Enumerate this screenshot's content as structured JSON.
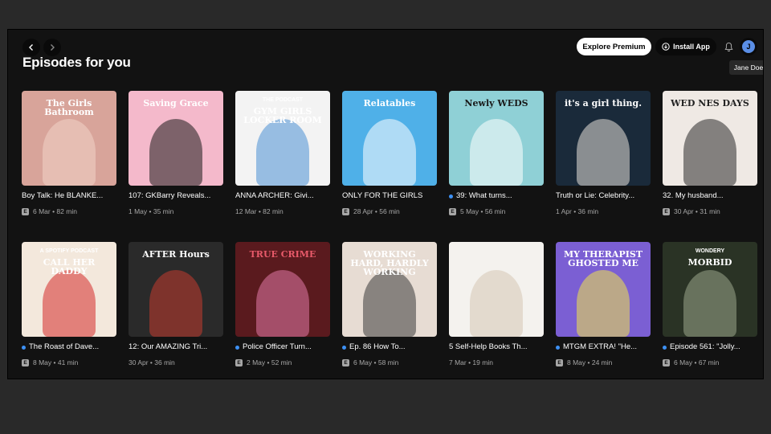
{
  "header": {
    "section_title": "Episodes for you",
    "explore_premium_label": "Explore Premium",
    "install_app_label": "Install App",
    "avatar_initial": "J",
    "tooltip_name": "Jane Doe"
  },
  "colors": {
    "background": "#121212",
    "outer": "#292929",
    "unplayed_dot": "#3d91f4",
    "avatar": "#5a8ee6"
  },
  "episodes": [
    {
      "title": "Boy Talk: He BLANKE...",
      "meta": "6 Mar • 82 min",
      "explicit": true,
      "unplayed": false,
      "cover": {
        "bg": "#d8a49a",
        "accent": "#f2d4c8",
        "text": "The Girls Bathroom",
        "text_color": "#ffffff"
      }
    },
    {
      "title": "107: GKBarry Reveals...",
      "meta": "1 May • 35 min",
      "explicit": false,
      "unplayed": false,
      "cover": {
        "bg": "#f4b9cb",
        "accent": "#1c1c1c",
        "text": "Saving Grace",
        "text_color": "#ffffff"
      }
    },
    {
      "title": "ANNA ARCHER: Givi...",
      "meta": "12 Mar • 82 min",
      "explicit": false,
      "unplayed": false,
      "cover": {
        "bg": "#f3f3f3",
        "accent": "#4a8fd3",
        "text": "GYM GIRLS LOCKER ROOM",
        "text_color": "#ffffff",
        "text2": "THE PODCAST"
      }
    },
    {
      "title": "ONLY FOR THE GIRLS",
      "meta": "28 Apr • 56 min",
      "explicit": true,
      "unplayed": false,
      "cover": {
        "bg": "#4fb0e8",
        "accent": "#ffffff",
        "text": "Relatables",
        "text_color": "#ffffff"
      }
    },
    {
      "title": "39: What turns...",
      "meta": "5 May • 56 min",
      "explicit": true,
      "unplayed": true,
      "cover": {
        "bg": "#8fd0d6",
        "accent": "#ffffff",
        "text": "Newly WEDS",
        "text_color": "#1a1a1a"
      }
    },
    {
      "title": "Truth or Lie: Celebrity...",
      "meta": "1 Apr • 36 min",
      "explicit": false,
      "unplayed": false,
      "cover": {
        "bg": "#1a2a3a",
        "accent": "#e8e0d8",
        "text": "it's a girl thing.",
        "text_color": "#ffffff"
      }
    },
    {
      "title": "32. My husband...",
      "meta": "30 Apr • 31 min",
      "explicit": true,
      "unplayed": false,
      "cover": {
        "bg": "#efe9e4",
        "accent": "#2a2a2a",
        "text": "WED NES DAYS",
        "text_color": "#222222"
      }
    },
    {
      "title": "The Roast of Dave...",
      "meta": "8 May • 41 min",
      "explicit": true,
      "unplayed": true,
      "cover": {
        "bg": "#f3e8dc",
        "accent": "#d42a2a",
        "text": "CALL HER DADDY",
        "text_color": "#ffffff",
        "text2": "A SPOTIFY PODCAST"
      }
    },
    {
      "title": "12: Our AMAZING Tri...",
      "meta": "30 Apr • 36 min",
      "explicit": false,
      "unplayed": false,
      "cover": {
        "bg": "#2a2a2a",
        "accent": "#c23a2e",
        "text": "AFTER Hours",
        "text_color": "#ffffff"
      }
    },
    {
      "title": "Police Officer Turn...",
      "meta": "2 May • 52 min",
      "explicit": true,
      "unplayed": true,
      "cover": {
        "bg": "#5a1a1e",
        "accent": "#e27aa8",
        "text": "TRUE CRIME",
        "text_color": "#e85a6a"
      }
    },
    {
      "title": "Ep. 86 How To...",
      "meta": "6 May • 58 min",
      "explicit": true,
      "unplayed": true,
      "cover": {
        "bg": "#e7dcd3",
        "accent": "#3a3a3a",
        "text": "WORKING HARD, HARDLY WORKING",
        "text_color": "#ffffff"
      }
    },
    {
      "title": "5 Self-Help Books Th...",
      "meta": "7 Mar • 19 min",
      "explicit": false,
      "unplayed": false,
      "cover": {
        "bg": "#f4f2ee",
        "accent": "#d6c7b5",
        "text": "",
        "text_color": "#333333"
      }
    },
    {
      "title": "MTGM EXTRA! \"He...",
      "meta": "8 May • 24 min",
      "explicit": true,
      "unplayed": true,
      "cover": {
        "bg": "#7b5fd3",
        "accent": "#f1e34a",
        "text": "MY THERAPIST GHOSTED ME",
        "text_color": "#ffffff"
      }
    },
    {
      "title": "Episode 561: \"Jolly...",
      "meta": "6 May • 67 min",
      "explicit": true,
      "unplayed": true,
      "cover": {
        "bg": "#2a3325",
        "accent": "#9aa68c",
        "text": "MORBID",
        "text_color": "#ffffff",
        "text2": "WONDERY"
      }
    }
  ]
}
